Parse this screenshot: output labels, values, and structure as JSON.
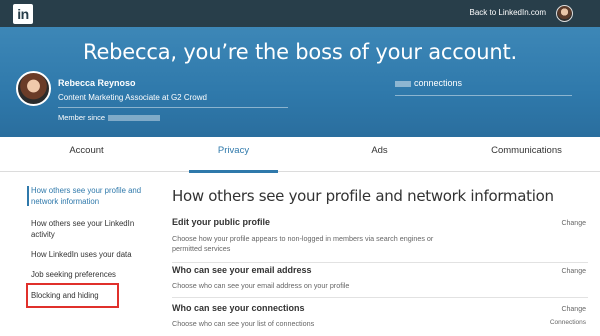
{
  "topbar": {
    "logo": "in",
    "back_link": "Back to LinkedIn.com"
  },
  "hero": {
    "title": "Rebecca, you’re the boss of your account.",
    "name": "Rebecca Reynoso",
    "headline": "Content Marketing Associate at G2 Crowd",
    "member_since": "Member since",
    "connections": "connections"
  },
  "tabs": [
    "Account",
    "Privacy",
    "Ads",
    "Communications"
  ],
  "sidebar": [
    "How others see your profile and network information",
    "How others see your LinkedIn activity",
    "How LinkedIn uses your data",
    "Job seeking preferences",
    "Blocking and hiding"
  ],
  "main": {
    "title": "How others see your profile and network information",
    "sections": [
      {
        "title": "Edit your public profile",
        "desc": "Choose how your profile appears to non-logged in members via search engines or permitted services",
        "action": "Change"
      },
      {
        "title": "Who can see your email address",
        "desc": "Choose who can see your email address on your profile",
        "action": "Change"
      },
      {
        "title": "Who can see your connections",
        "desc": "Choose who can see your list of connections",
        "action": "Change",
        "sub": "Connections"
      }
    ]
  },
  "colors": {
    "accent": "#2f79ab",
    "topbar": "#283e4a",
    "highlight": "#e0302b"
  }
}
